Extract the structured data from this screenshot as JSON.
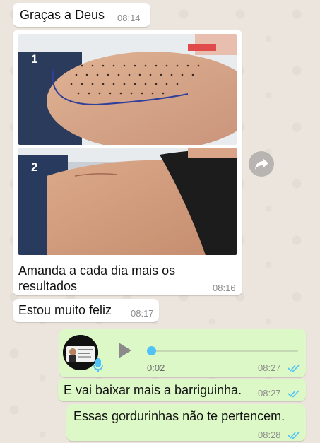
{
  "messages": [
    {
      "text": "Graças a Deus",
      "time": "08:14"
    },
    {
      "caption": "Amanda a cada dia mais os resultados",
      "caption_line1": "Amanda a cada dia mais os",
      "caption_line2": "resultados",
      "time": "08:16",
      "photos": [
        {
          "label": "1"
        },
        {
          "label": "2"
        }
      ]
    },
    {
      "text": "Estou muito feliz",
      "time": "08:17"
    },
    {
      "type": "voice",
      "duration": "0:02",
      "time": "08:27",
      "status": "read"
    },
    {
      "text": "E vai baixar mais a barriguinha.",
      "time": "08:27",
      "status": "read"
    },
    {
      "text": "Essas gordurinhas não te pertencem.",
      "time": "08:28",
      "status": "read"
    }
  ],
  "colors": {
    "incoming": "#ffffff",
    "outgoing": "#dcf8c6",
    "read_ticks": "#4fc3f7",
    "mic": "#4fc3f7",
    "play": "#8a8a8a"
  },
  "icons": {
    "forward": "forward-arrow-icon",
    "play": "play-icon",
    "mic": "microphone-icon",
    "ticks": "double-check-icon"
  }
}
